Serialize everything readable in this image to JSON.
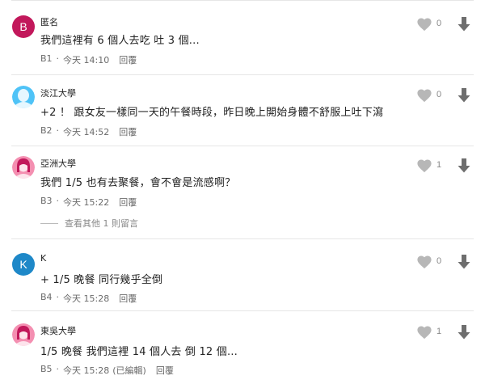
{
  "comments": [
    {
      "avatar_letter": "B",
      "avatar_color": "#c2185b",
      "author": "匿名",
      "text": "我們這裡有 6 個人去吃 吐 3 個...",
      "floor": "B1",
      "time": "今天 14:10",
      "edited": "",
      "reply": "回覆",
      "likes": "0"
    },
    {
      "avatar_color": "#4fc3f7",
      "author": "淡江大學",
      "text": "+2 ！ 跟女友一樣同一天的午餐時段，昨日晚上開始身體不舒服上吐下瀉",
      "floor": "B2",
      "time": "今天 14:52",
      "edited": "",
      "reply": "回覆",
      "likes": "0"
    },
    {
      "avatar_color": "#f48fb1",
      "author": "亞洲大學",
      "text": "我們 1/5 也有去聚餐，會不會是流感啊？",
      "floor": "B3",
      "time": "今天 15:22",
      "edited": "",
      "reply": "回覆",
      "likes": "1",
      "view_more": "查看其他 1 則留言"
    },
    {
      "avatar_letter": "K",
      "avatar_color": "#1e88c8",
      "author": "K",
      "text": "+ 1/5 晚餐 同行幾乎全倒",
      "floor": "B4",
      "time": "今天 15:28",
      "edited": "",
      "reply": "回覆",
      "likes": "0"
    },
    {
      "avatar_color": "#f48fb1",
      "author": "東吳大學",
      "text": "1/5 晚餐 我們這裡 14 個人去 倒 12 個…",
      "floor": "B5",
      "time": "今天 15:28",
      "edited": "(已編輯)",
      "reply": "回覆",
      "likes": "1"
    }
  ],
  "icons": {
    "heart": "heart-icon",
    "down": "arrow-down-icon",
    "female_avatar": "female-avatar-icon"
  }
}
